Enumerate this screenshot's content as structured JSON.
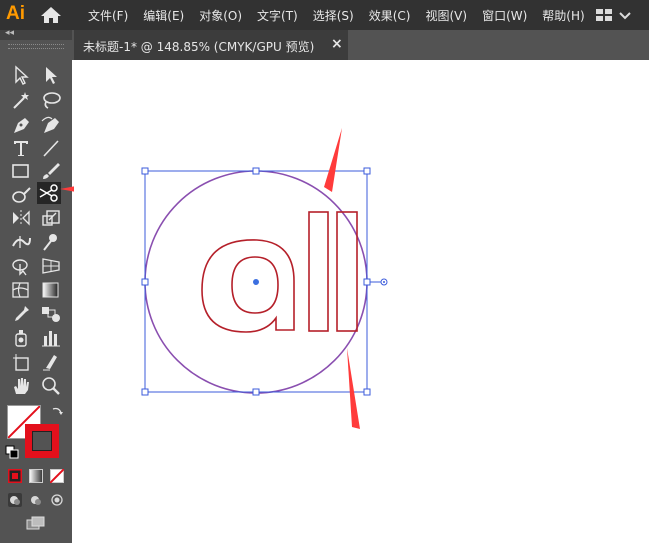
{
  "app": {
    "logo_text": "Ai"
  },
  "menubar": {
    "items": [
      "文件(F)",
      "编辑(E)",
      "对象(O)",
      "文字(T)",
      "选择(S)",
      "效果(C)",
      "视图(V)",
      "窗口(W)",
      "帮助(H)"
    ],
    "icons": [
      "home-icon",
      "workspace-switcher-icon"
    ]
  },
  "toolbar": {
    "collapse_label": "◂◂",
    "tools": [
      "selection-tool",
      "direct-selection-tool",
      "magic-wand-tool",
      "lasso-tool",
      "pen-tool",
      "curvature-tool",
      "type-tool",
      "line-segment-tool",
      "rectangle-tool",
      "paintbrush-tool",
      "shaper-tool",
      "scissors-tool",
      "rotate-tool",
      "scale-tool",
      "width-tool",
      "puppet-warp-tool",
      "shape-builder-tool",
      "perspective-grid-tool",
      "mesh-tool",
      "gradient-tool",
      "eyedropper-tool",
      "blend-tool",
      "symbol-sprayer-tool",
      "column-graph-tool",
      "artboard-tool",
      "slice-tool",
      "hand-tool",
      "zoom-tool"
    ],
    "active_tool": "scissors-tool",
    "fill_color": "none",
    "stroke_color": "#e3101c"
  },
  "document_tab": {
    "title": "未标题-1* @ 148.85% (CMYK/GPU 预览)",
    "close_label": "×"
  },
  "artwork": {
    "text": "all",
    "text_stroke_color": "#b5202a",
    "circle_stroke_color": "#8a4fb0",
    "selection_color": "#3b5bdb",
    "arrow_color": "#ff3b3b"
  }
}
